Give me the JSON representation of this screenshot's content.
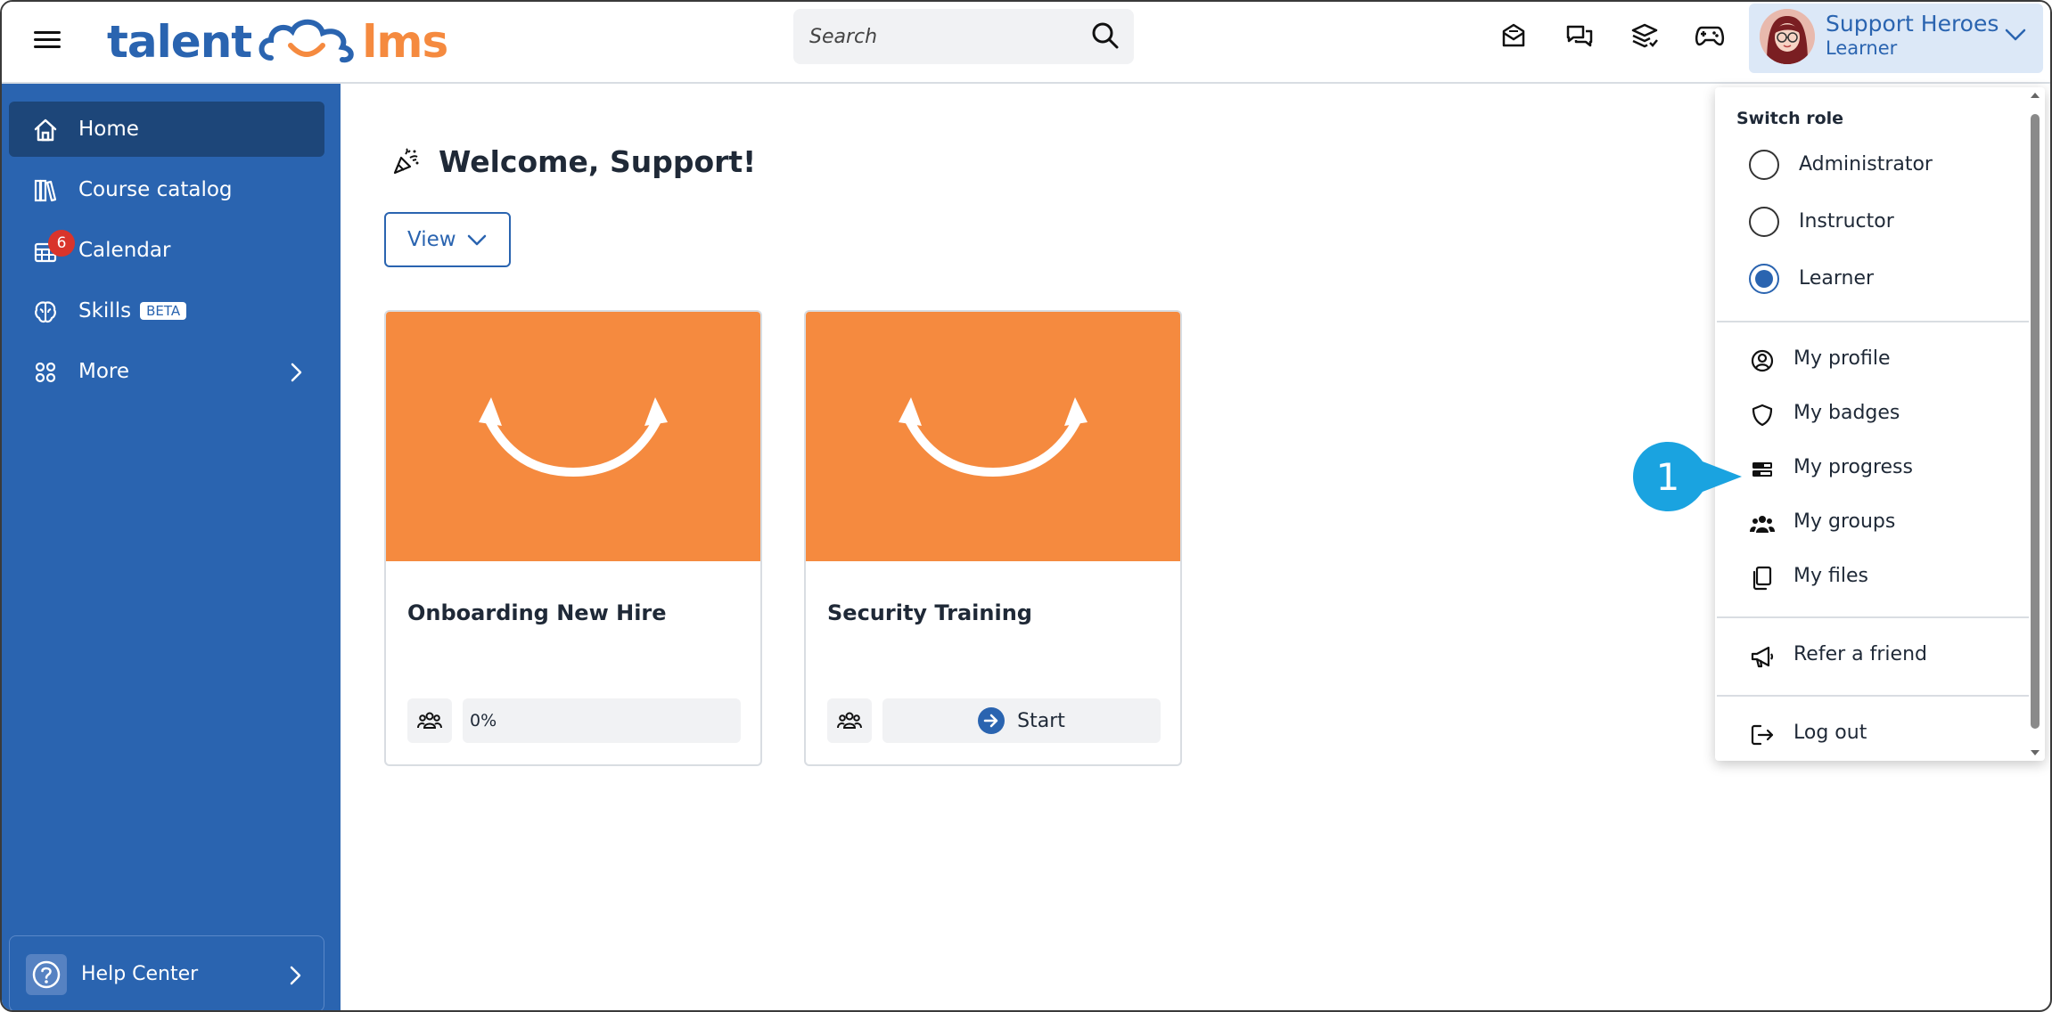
{
  "header": {
    "logo_left": "talent",
    "logo_right": "lms",
    "search_placeholder": "Search",
    "user_name": "Support Heroes",
    "user_role": "Learner"
  },
  "sidebar": {
    "items": [
      {
        "label": "Home",
        "icon": "home-icon"
      },
      {
        "label": "Course catalog",
        "icon": "books-icon"
      },
      {
        "label": "Calendar",
        "icon": "calendar-icon",
        "badge": "6"
      },
      {
        "label": "Skills",
        "icon": "brain-icon",
        "tag": "BETA"
      },
      {
        "label": "More",
        "icon": "grid-icon"
      }
    ],
    "help_label": "Help Center"
  },
  "main": {
    "welcome": "Welcome, Support!",
    "view_label": "View",
    "courses": [
      {
        "title": "Onboarding New Hire",
        "progress": "0%"
      },
      {
        "title": "Security Training",
        "action": "Start"
      }
    ]
  },
  "dropdown": {
    "title": "Switch role",
    "roles": [
      {
        "label": "Administrator",
        "selected": false
      },
      {
        "label": "Instructor",
        "selected": false
      },
      {
        "label": "Learner",
        "selected": true
      }
    ],
    "items": [
      {
        "label": "My profile",
        "icon": "user-circle-icon"
      },
      {
        "label": "My badges",
        "icon": "shield-icon"
      },
      {
        "label": "My progress",
        "icon": "progress-icon"
      },
      {
        "label": "My groups",
        "icon": "group-icon"
      },
      {
        "label": "My files",
        "icon": "files-icon"
      }
    ],
    "refer_label": "Refer a friend",
    "logout_label": "Log out"
  },
  "callout": {
    "step": "1"
  },
  "colors": {
    "primary": "#2a64b0",
    "accent": "#f58a3f",
    "sidebar_active": "#1d4679"
  }
}
